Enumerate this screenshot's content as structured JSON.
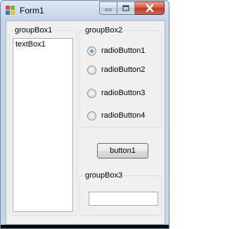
{
  "window": {
    "title": "Form1"
  },
  "groupBox1": {
    "label": "groupBox1",
    "textbox_value": "textBox1"
  },
  "groupBox2": {
    "label": "groupBox2",
    "radios": [
      {
        "label": "radioButton1",
        "checked": true
      },
      {
        "label": "radioButton2",
        "checked": false
      },
      {
        "label": "radioButton3",
        "checked": false
      },
      {
        "label": "radioButton4",
        "checked": false
      }
    ]
  },
  "button1": {
    "label": "button1"
  },
  "groupBox3": {
    "label": "groupBox3",
    "textbox_value": ""
  },
  "icons": [
    "app-icon",
    "minimize-icon",
    "maximize-icon",
    "close-icon"
  ]
}
